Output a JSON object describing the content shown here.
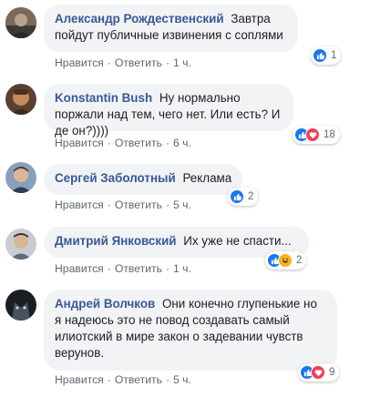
{
  "comments": [
    {
      "author": "Александр Рождественский",
      "text": "Завтра пойдут публичные извинения с соплями",
      "like_label": "Нравится",
      "reply_label": "Ответить",
      "time": "1 ч.",
      "reaction_count": "1",
      "reactions": [
        "like-icon"
      ]
    },
    {
      "author": "Konstantin Bush",
      "text": "Ну нормально поржали над тем, чего нет. Или есть? И де он?))))",
      "like_label": "Нравится",
      "reply_label": "Ответить",
      "time": "6 ч.",
      "reaction_count": "18",
      "reactions": [
        "like-icon",
        "love-icon"
      ]
    },
    {
      "author": "Сергей Заболотный",
      "text": "Реклама",
      "like_label": "Нравится",
      "reply_label": "Ответить",
      "time": "5 ч.",
      "reaction_count": "2",
      "reactions": [
        "like-icon"
      ]
    },
    {
      "author": "Дмитрий Янковский",
      "text": "Их уже не спасти...",
      "like_label": "Нравится",
      "reply_label": "Ответить",
      "time": "1 ч.",
      "reaction_count": "2",
      "reactions": [
        "like-icon",
        "haha-icon"
      ]
    },
    {
      "author": "Андрей Волчков",
      "text": "Они конечно глупенькие но я надеюсь это не повод создавать самый илиотский в мире закон о задевании чувств верунов.",
      "like_label": "Нравится",
      "reply_label": "Ответить",
      "time": "5 ч.",
      "reaction_count": "9",
      "reactions": [
        "like-icon",
        "love-icon"
      ]
    }
  ],
  "colors": {
    "author": "#385898",
    "bubble": "#f2f3f5",
    "meta": "#606770",
    "like": "#1877f2",
    "love": "#f33e58",
    "haha": "#f7b125"
  }
}
